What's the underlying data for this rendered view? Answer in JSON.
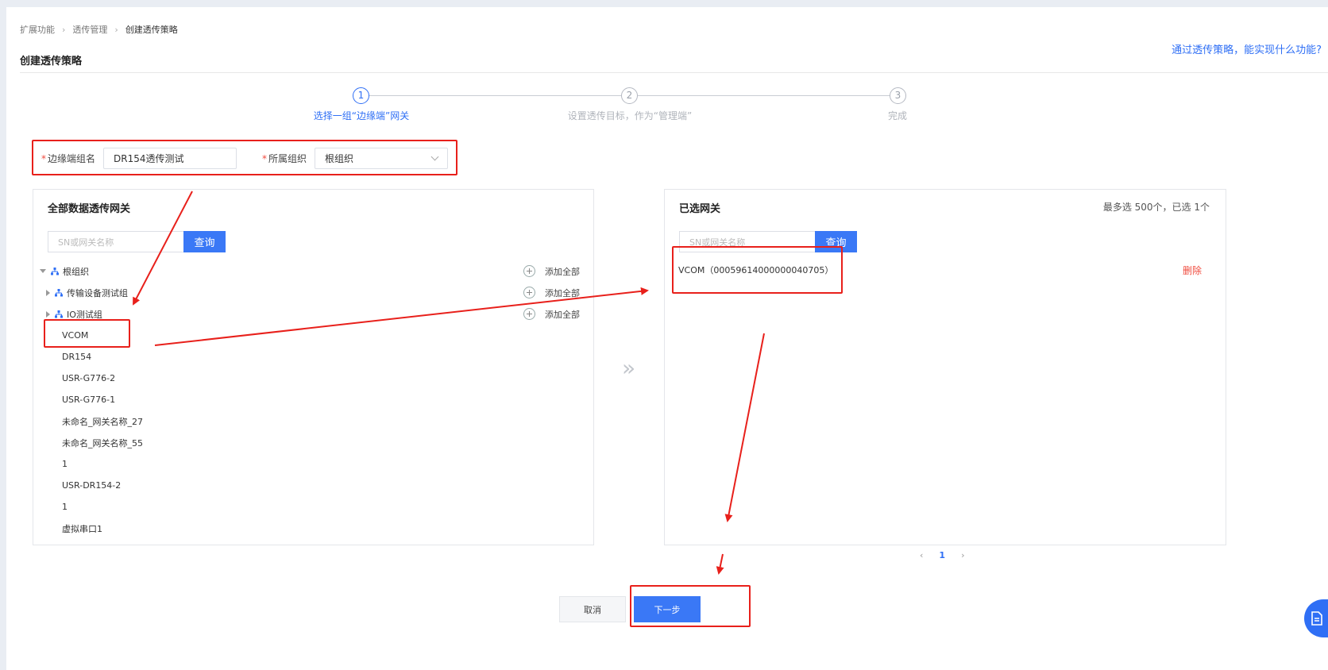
{
  "breadcrumb": [
    "扩展功能",
    "透传管理",
    "创建透传策略"
  ],
  "page_title": "创建透传策略",
  "help_link": "通过透传策略，能实现什么功能?",
  "steps": [
    {
      "num": "1",
      "label": "选择一组“边缘端”网关"
    },
    {
      "num": "2",
      "label": "设置透传目标，作为“管理端”"
    },
    {
      "num": "3",
      "label": "完成"
    }
  ],
  "form": {
    "group_name_label": "边缘端组名",
    "group_name_value": "DR154透传测试",
    "org_label": "所属组织",
    "org_value": "根组织"
  },
  "left_panel": {
    "title": "全部数据透传网关",
    "search_placeholder": "SN或网关名称",
    "search_button": "查询",
    "add_all_label": "添加全部",
    "root": "根组织",
    "groups": [
      "传输设备测试组",
      "IO测试组"
    ],
    "items": [
      "VCOM",
      "DR154",
      "USR-G776-2",
      "USR-G776-1",
      "未命名_网关名称_27",
      "未命名_网关名称_55",
      "1",
      "USR-DR154-2",
      "1",
      "虚拟串口1"
    ]
  },
  "right_panel": {
    "title": "已选网关",
    "meta": "最多选 500个，已选 1个",
    "search_placeholder": "SN或网关名称",
    "search_button": "查询",
    "selected_item": "VCOM（00059614000000040705）",
    "delete_label": "删除"
  },
  "transfer_icon": "»",
  "pager": {
    "prev": "‹",
    "current": "1",
    "next": "›"
  },
  "buttons": {
    "cancel": "取消",
    "next": "下一步"
  },
  "colors": {
    "primary": "#3a78f6",
    "danger": "#f04c3f",
    "annotation": "#e8201b"
  }
}
